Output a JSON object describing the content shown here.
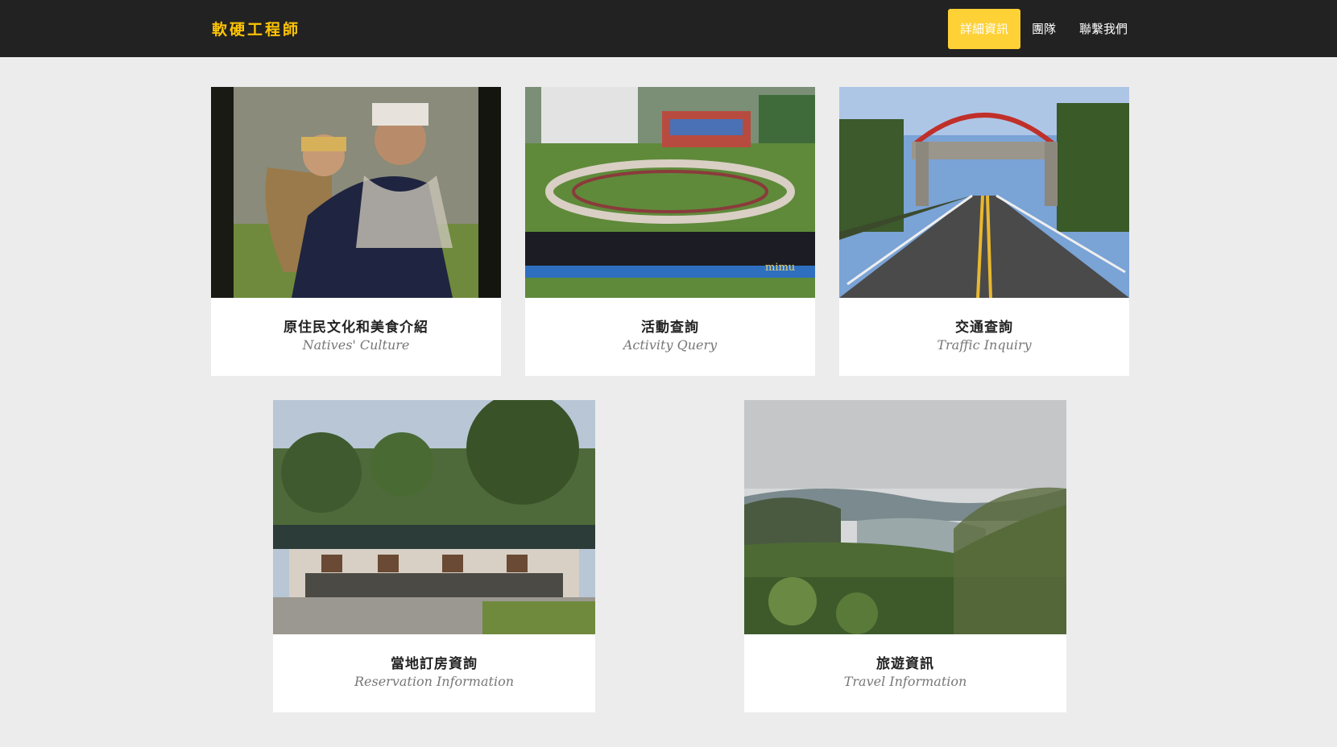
{
  "navbar": {
    "brand": "軟硬工程師",
    "items": [
      "詳細資訊",
      "團隊",
      "聯繫我們"
    ],
    "active_color": "#fed136",
    "brand_color": "#fec503"
  },
  "cards": [
    {
      "title": "原住民文化和美食介紹",
      "subtitle": "Natives' Culture",
      "image": "photo-woman-with-child"
    },
    {
      "title": "活動查詢",
      "subtitle": "Activity Query",
      "image": "photo-festival-circle-dance",
      "watermark": "mimu"
    },
    {
      "title": "交通查詢",
      "subtitle": "Traffic Inquiry",
      "image": "photo-road-gate"
    },
    {
      "title": "當地訂房資詢",
      "subtitle": "Reservation Information",
      "image": "photo-guesthouse"
    },
    {
      "title": "旅遊資訊",
      "subtitle": "Travel Information",
      "image": "photo-valley-view"
    }
  ]
}
